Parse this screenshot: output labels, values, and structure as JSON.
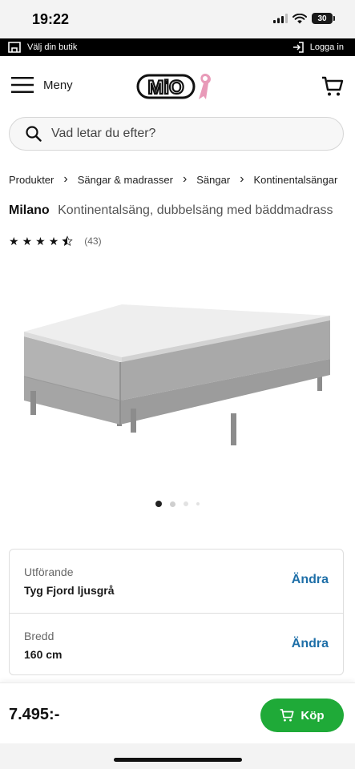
{
  "status_bar": {
    "time": "19:22",
    "battery": "30"
  },
  "store_bar": {
    "store_label": "Välj din butik",
    "login_label": "Logga in"
  },
  "header": {
    "menu_label": "Meny",
    "logo_text": "MiO"
  },
  "search": {
    "placeholder": "Vad letar du efter?"
  },
  "breadcrumb": [
    "Produkter",
    "Sängar & madrasser",
    "Sängar",
    "Kontinentalsängar"
  ],
  "product": {
    "name": "Milano",
    "description": "Kontinentalsäng, dubbelsäng med bäddmadrass",
    "rating": 4.5,
    "review_count": "(43)",
    "image_count": 4,
    "active_image": 1
  },
  "options": [
    {
      "label": "Utförande",
      "value": "Tyg Fjord ljusgrå",
      "action": "Ändra"
    },
    {
      "label": "Bredd",
      "value": "160 cm",
      "action": "Ändra"
    }
  ],
  "footer": {
    "price": "7.495:-",
    "buy_label": "Köp"
  },
  "colors": {
    "accent": "#1faa38",
    "link": "#1e6fa8",
    "logo_ribbon": "#e89ab8"
  }
}
